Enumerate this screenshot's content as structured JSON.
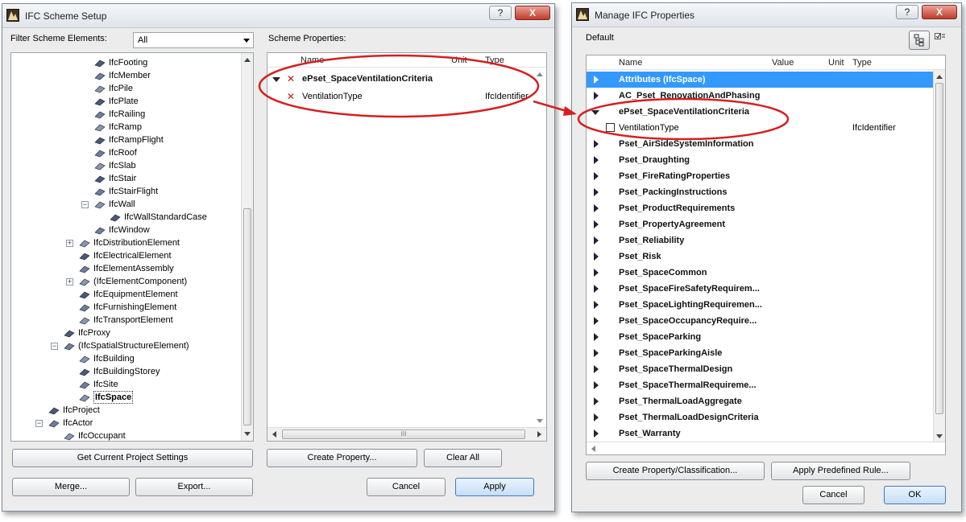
{
  "left_dialog": {
    "title": "IFC Scheme Setup",
    "help_label": "?",
    "close_label": "X",
    "filter_label": "Filter Scheme Elements:",
    "filter_value": "All",
    "scheme_properties_label": "Scheme Properties:",
    "tree": [
      {
        "label": "IfcFooting",
        "icon": "footing-icon",
        "level": 3
      },
      {
        "label": "IfcMember",
        "icon": "member-icon",
        "level": 3
      },
      {
        "label": "IfcPile",
        "icon": "pile-icon",
        "level": 3
      },
      {
        "label": "IfcPlate",
        "icon": "plate-icon",
        "level": 3
      },
      {
        "label": "IfcRailing",
        "icon": "railing-icon",
        "level": 3
      },
      {
        "label": "IfcRamp",
        "icon": "ramp-icon",
        "level": 3
      },
      {
        "label": "IfcRampFlight",
        "icon": "ramp-flight-icon",
        "level": 3
      },
      {
        "label": "IfcRoof",
        "icon": "roof-icon",
        "level": 3
      },
      {
        "label": "IfcSlab",
        "icon": "slab-icon",
        "level": 3
      },
      {
        "label": "IfcStair",
        "icon": "stair-icon",
        "level": 3
      },
      {
        "label": "IfcStairFlight",
        "icon": "stair-flight-icon",
        "level": 3
      },
      {
        "label": "IfcWall",
        "icon": "wall-icon",
        "level": 3,
        "expander": "−"
      },
      {
        "label": "IfcWallStandardCase",
        "icon": "wall-standard-case-icon",
        "level": 4
      },
      {
        "label": "IfcWindow",
        "icon": "window-icon",
        "level": 3
      },
      {
        "label": "IfcDistributionElement",
        "icon": "distribution-element-icon",
        "level": 2,
        "expander": "+"
      },
      {
        "label": "IfcElectricalElement",
        "icon": "electrical-element-icon",
        "level": 2
      },
      {
        "label": "IfcElementAssembly",
        "icon": "element-assembly-icon",
        "level": 2
      },
      {
        "label": "(IfcElementComponent)",
        "icon": "element-component-icon",
        "level": 2,
        "expander": "+"
      },
      {
        "label": "IfcEquipmentElement",
        "icon": "equipment-element-icon",
        "level": 2
      },
      {
        "label": "IfcFurnishingElement",
        "icon": "furnishing-element-icon",
        "level": 2
      },
      {
        "label": "IfcTransportElement",
        "icon": "transport-element-icon",
        "level": 2
      },
      {
        "label": "IfcProxy",
        "icon": "proxy-icon",
        "level": 1
      },
      {
        "label": "(IfcSpatialStructureElement)",
        "icon": "spatial-structure-icon",
        "level": 1,
        "expander": "−"
      },
      {
        "label": "IfcBuilding",
        "icon": "building-icon",
        "level": 2
      },
      {
        "label": "IfcBuildingStorey",
        "icon": "building-storey-icon",
        "level": 2
      },
      {
        "label": "IfcSite",
        "icon": "site-icon",
        "level": 2
      },
      {
        "label": "IfcSpace",
        "icon": "space-icon",
        "level": 2,
        "selected": true
      },
      {
        "label": "IfcProject",
        "icon": "project-icon",
        "level": 0
      },
      {
        "label": "IfcActor",
        "icon": "actor-icon",
        "level": 0,
        "expander": "−"
      },
      {
        "label": "IfcOccupant",
        "icon": "occupant-icon",
        "level": 1
      }
    ],
    "columns": {
      "name": "Name",
      "unit": "Unit",
      "type": "Type"
    },
    "pset_group": "ePset_SpaceVentilationCriteria",
    "property": {
      "name": "VentilationType",
      "type": "IfcIdentifier"
    },
    "hscroll_grip": "III",
    "buttons": {
      "get_settings": "Get Current Project Settings",
      "create_property": "Create Property...",
      "clear_all": "Clear All",
      "merge": "Merge...",
      "export": "Export...",
      "cancel": "Cancel",
      "apply": "Apply"
    }
  },
  "right_dialog": {
    "title": "Manage IFC Properties",
    "help_label": "?",
    "close_label": "X",
    "default_label": "Default",
    "columns": {
      "name": "Name",
      "value": "Value",
      "unit": "Unit",
      "type": "Type"
    },
    "rows": [
      {
        "label": "Attributes (IfcSpace)",
        "selected": true
      },
      {
        "label": "AC_Pset_RenovationAndPhasing"
      },
      {
        "label": "ePset_SpaceVentilationCriteria",
        "expanded": true
      },
      {
        "label": "Pset_AirSideSystemInformation"
      },
      {
        "label": "Pset_Draughting"
      },
      {
        "label": "Pset_FireRatingProperties"
      },
      {
        "label": "Pset_PackingInstructions"
      },
      {
        "label": "Pset_ProductRequirements"
      },
      {
        "label": "Pset_PropertyAgreement"
      },
      {
        "label": "Pset_Reliability"
      },
      {
        "label": "Pset_Risk"
      },
      {
        "label": "Pset_SpaceCommon"
      },
      {
        "label": "Pset_SpaceFireSafetyRequirem..."
      },
      {
        "label": "Pset_SpaceLightingRequiremen..."
      },
      {
        "label": "Pset_SpaceOccupancyRequire..."
      },
      {
        "label": "Pset_SpaceParking"
      },
      {
        "label": "Pset_SpaceParkingAisle"
      },
      {
        "label": "Pset_SpaceThermalDesign"
      },
      {
        "label": "Pset_SpaceThermalRequireme..."
      },
      {
        "label": "Pset_ThermalLoadAggregate"
      },
      {
        "label": "Pset_ThermalLoadDesignCriteria"
      },
      {
        "label": "Pset_Warranty"
      }
    ],
    "property": {
      "name": "VentilationType",
      "type": "IfcIdentifier"
    },
    "buttons": {
      "create_property_classification": "Create Property/Classification...",
      "apply_predefined_rule": "Apply Predefined Rule...",
      "cancel": "Cancel",
      "ok": "OK"
    }
  },
  "colors": {
    "selection": "#3399ff",
    "annotation_red": "#d42020",
    "dialog_bg": "#ececec"
  }
}
